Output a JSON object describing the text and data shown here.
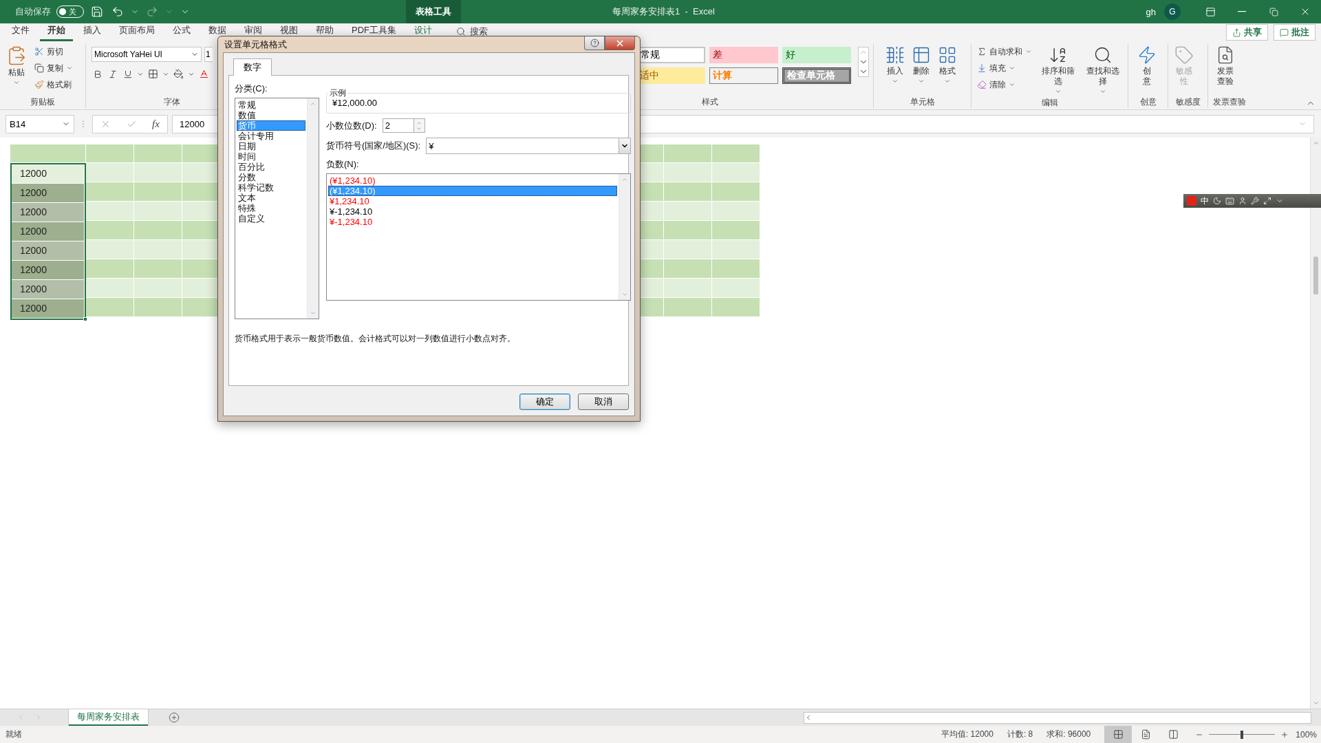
{
  "title_bar": {
    "autosave_label": "自动保存",
    "autosave": {
      "label": "关",
      "on": false
    },
    "context_tab": "表格工具",
    "title": "每周家务安排表1  -  Excel",
    "user": "gh",
    "avatar": "G"
  },
  "ribbon_tabs": [
    {
      "label": "文件",
      "selected": false,
      "kind": "normal"
    },
    {
      "label": "开始",
      "selected": true,
      "kind": "normal"
    },
    {
      "label": "插入",
      "selected": false,
      "kind": "normal"
    },
    {
      "label": "页面布局",
      "selected": false,
      "kind": "normal"
    },
    {
      "label": "公式",
      "selected": false,
      "kind": "normal"
    },
    {
      "label": "数据",
      "selected": false,
      "kind": "normal"
    },
    {
      "label": "审阅",
      "selected": false,
      "kind": "normal"
    },
    {
      "label": "视图",
      "selected": false,
      "kind": "normal"
    },
    {
      "label": "帮助",
      "selected": false,
      "kind": "normal"
    },
    {
      "label": "PDF工具集",
      "selected": false,
      "kind": "normal"
    },
    {
      "label": "设计",
      "selected": false,
      "kind": "contextual"
    }
  ],
  "search": {
    "placeholder": "搜索"
  },
  "share_button": "共享",
  "comments_button": "批注",
  "ribbon": {
    "clipboard": {
      "paste": "粘贴",
      "cut": "剪切",
      "copy": "复制",
      "format_painter": "格式刷",
      "label": "剪贴板"
    },
    "font": {
      "name": "Microsoft YaHei UI",
      "size": "1",
      "label": "字体"
    },
    "styles": {
      "cells": [
        {
          "label": "常规",
          "kind": "normal"
        },
        {
          "label": "差",
          "kind": "bad"
        },
        {
          "label": "好",
          "kind": "good"
        },
        {
          "label": "适中",
          "kind": "neutral"
        },
        {
          "label": "计算",
          "kind": "calculation"
        },
        {
          "label": "检查单元格",
          "kind": "check"
        }
      ],
      "label": "样式"
    },
    "cells": {
      "buttons": [
        "插入",
        "删除",
        "格式"
      ],
      "label": "单元格"
    },
    "editing": {
      "autosum": "自动求和",
      "fill": "填充",
      "clear": "清除",
      "sort": "排序和筛选",
      "find": "查找和选择",
      "label": "编辑"
    },
    "ideas": {
      "button": "创意",
      "label": "创意"
    },
    "sensitivity": {
      "button": "敏感性",
      "disabled": true,
      "label": "敏感度"
    },
    "invoice": {
      "button": "发票查验",
      "label": "发票查验"
    }
  },
  "formula_bar": {
    "name_box": "B14",
    "more": "⋮",
    "function_label": "fx",
    "value": "12000"
  },
  "sheet": {
    "rows": [
      {
        "cell": "12000",
        "active": true
      },
      {
        "cell": "12000",
        "active": false
      },
      {
        "cell": "12000",
        "active": false
      },
      {
        "cell": "12000",
        "active": false
      },
      {
        "cell": "12000",
        "active": false
      },
      {
        "cell": "12000",
        "active": false
      },
      {
        "cell": "12000",
        "active": false
      },
      {
        "cell": "12000",
        "active": false
      }
    ]
  },
  "ime_toolbar": {
    "mode": "中"
  },
  "dialog": {
    "title": "设置单元格格式",
    "tabs": [
      {
        "label": "数字",
        "selected": true
      }
    ],
    "category_label": "分类(C):",
    "categories": [
      {
        "label": "常规",
        "selected": false
      },
      {
        "label": "数值",
        "selected": false
      },
      {
        "label": "货币",
        "selected": true
      },
      {
        "label": "会计专用",
        "selected": false
      },
      {
        "label": "日期",
        "selected": false
      },
      {
        "label": "时间",
        "selected": false
      },
      {
        "label": "百分比",
        "selected": false
      },
      {
        "label": "分数",
        "selected": false
      },
      {
        "label": "科学记数",
        "selected": false
      },
      {
        "label": "文本",
        "selected": false
      },
      {
        "label": "特殊",
        "selected": false
      },
      {
        "label": "自定义",
        "selected": false
      }
    ],
    "sample_label": "示例",
    "sample_value": "¥12,000.00",
    "decimal_label": "小数位数(D):",
    "decimal_value": "2",
    "currency_label": "货币符号(国家/地区)(S):",
    "currency_value": "¥",
    "negative_label": "负数(N):",
    "negatives": [
      {
        "text": "(¥1,234.10)",
        "color": "#ff0000",
        "selected": false
      },
      {
        "text": "(¥1,234.10)",
        "selected": true
      },
      {
        "text": "¥1,234.10",
        "color": "#ff0000",
        "selected": false
      },
      {
        "text": "¥-1,234.10",
        "color": "#000000",
        "selected": false
      },
      {
        "text": "¥-1,234.10",
        "color": "#ff0000",
        "selected": false
      }
    ],
    "description": "货币格式用于表示一般货币数值。会计格式可以对一列数值进行小数点对齐。",
    "ok": "确定",
    "cancel": "取消"
  },
  "sheet_tabs": [
    {
      "label": "每周家务安排表",
      "selected": true
    }
  ],
  "status_bar": {
    "ready": "就绪",
    "average": "平均值: 12000",
    "count": "计数: 8",
    "sum": "求和: 96000",
    "views": [
      {
        "kind": "normal",
        "selected": true
      },
      {
        "kind": "page_layout",
        "selected": false
      },
      {
        "kind": "page_break",
        "selected": false
      }
    ],
    "zoom": {
      "level": 0.5
    },
    "zoom_label": "100%"
  }
}
